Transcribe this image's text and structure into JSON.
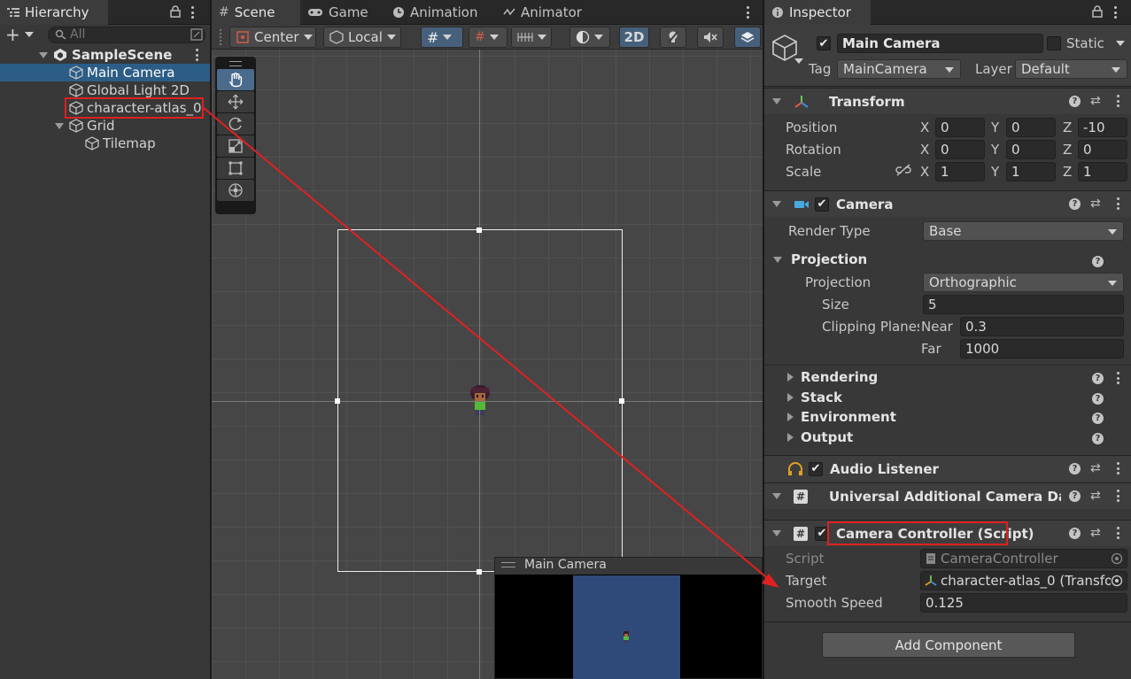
{
  "hierarchy": {
    "tab_label": "Hierarchy",
    "search_placeholder": "All",
    "items": [
      {
        "label": "SampleScene"
      },
      {
        "label": "Main Camera"
      },
      {
        "label": "Global Light 2D"
      },
      {
        "label": "character-atlas_0"
      },
      {
        "label": "Grid"
      },
      {
        "label": "Tilemap"
      }
    ]
  },
  "scene": {
    "tabs": [
      {
        "label": "Scene"
      },
      {
        "label": "Game"
      },
      {
        "label": "Animation"
      },
      {
        "label": "Animator"
      }
    ],
    "toolbar": {
      "pivot": "Center",
      "space": "Local",
      "mode_2d": "2D"
    },
    "camera_preview_title": "Main Camera",
    "camera_preview_bg": "#2f4a78"
  },
  "inspector": {
    "tab_label": "Inspector",
    "object_name": "Main Camera",
    "static_label": "Static",
    "tag_label": "Tag",
    "tag_value": "MainCamera",
    "layer_label": "Layer",
    "layer_value": "Default",
    "transform": {
      "title": "Transform",
      "position_label": "Position",
      "rotation_label": "Rotation",
      "scale_label": "Scale",
      "position": {
        "x": "0",
        "y": "0",
        "z": "-10"
      },
      "rotation": {
        "x": "0",
        "y": "0",
        "z": "0"
      },
      "scale": {
        "x": "1",
        "y": "1",
        "z": "1"
      },
      "axis_x": "X",
      "axis_y": "Y",
      "axis_z": "Z"
    },
    "camera": {
      "title": "Camera",
      "render_type_label": "Render Type",
      "render_type_value": "Base",
      "projection_header": "Projection",
      "projection_label": "Projection",
      "projection_value": "Orthographic",
      "size_label": "Size",
      "size_value": "5",
      "clipping_label": "Clipping Planes",
      "near_label": "Near",
      "near_value": "0.3",
      "far_label": "Far",
      "far_value": "1000",
      "rendering": "Rendering",
      "stack": "Stack",
      "environment": "Environment",
      "output": "Output"
    },
    "audio_listener": "Audio Listener",
    "universal_data": "Universal Additional Camera Data (",
    "camera_controller": {
      "title": "Camera Controller (Script)",
      "script_label": "Script",
      "script_value": "CameraController",
      "target_label": "Target",
      "target_value": "character-atlas_0 (Transfo",
      "speed_label": "Smooth Speed",
      "speed_value": "0.125"
    },
    "add_component": "Add Component"
  },
  "colors": {
    "selection": "#2c5d87",
    "annotation": "#e02020",
    "accent_blue": "#46607c"
  }
}
